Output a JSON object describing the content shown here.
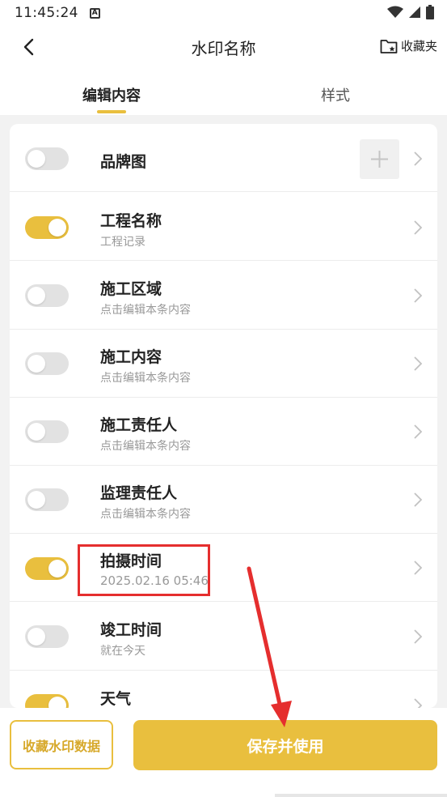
{
  "status_bar": {
    "time": "11:45:24",
    "notification_icon": "a-icon",
    "icons": [
      "wifi-icon",
      "signal-icon",
      "battery-icon"
    ]
  },
  "header": {
    "title": "水印名称",
    "back_icon": "chevron-left-icon",
    "favorites_label": "收藏夹",
    "favorites_icon": "folder-star-icon"
  },
  "tabs": [
    {
      "label": "编辑内容",
      "active": true
    },
    {
      "label": "样式",
      "active": false
    }
  ],
  "items": [
    {
      "title": "品牌图",
      "subtitle": "",
      "enabled": false,
      "has_add": true
    },
    {
      "title": "工程名称",
      "subtitle": "工程记录",
      "enabled": true
    },
    {
      "title": "施工区域",
      "subtitle": "点击编辑本条内容",
      "enabled": false
    },
    {
      "title": "施工内容",
      "subtitle": "点击编辑本条内容",
      "enabled": false
    },
    {
      "title": "施工责任人",
      "subtitle": "点击编辑本条内容",
      "enabled": false
    },
    {
      "title": "监理责任人",
      "subtitle": "点击编辑本条内容",
      "enabled": false
    },
    {
      "title": "拍摄时间",
      "subtitle": "2025.02.16 05:46",
      "enabled": true
    },
    {
      "title": "竣工时间",
      "subtitle": "就在今天",
      "enabled": false
    },
    {
      "title": "天气",
      "subtitle": "",
      "enabled": true
    }
  ],
  "footer": {
    "collect_label": "收藏水印数据",
    "save_label": "保存并使用"
  },
  "colors": {
    "accent": "#e9bf3e",
    "annotation": "#e52e2e"
  }
}
